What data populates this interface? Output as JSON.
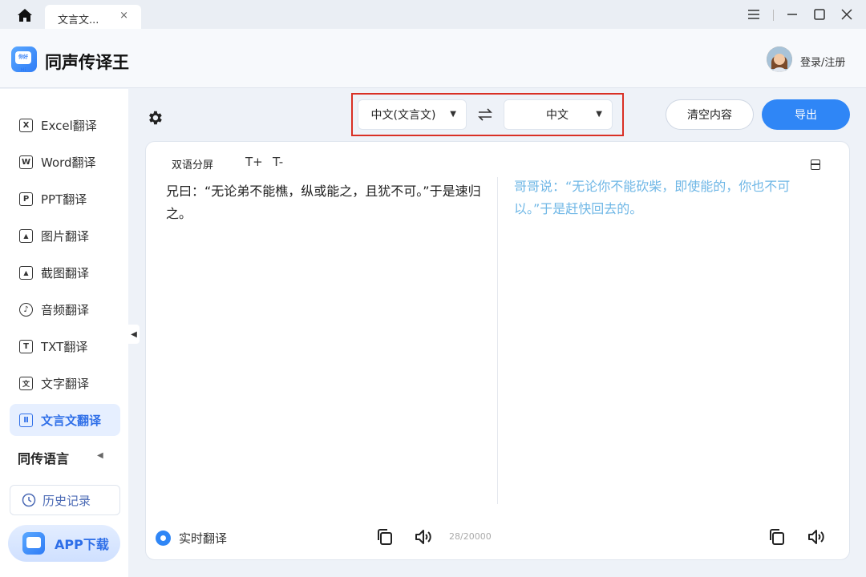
{
  "titlebar": {
    "tab_label": "文言文...",
    "tab_close": "×"
  },
  "header": {
    "app_title": "同声传译王",
    "logo_text": "你好 Hi",
    "login_label": "登录/注册"
  },
  "sidebar": {
    "items": [
      {
        "label": "Excel翻译",
        "icon": "X"
      },
      {
        "label": "Word翻译",
        "icon": "W"
      },
      {
        "label": "PPT翻译",
        "icon": "P"
      },
      {
        "label": "图片翻译",
        "icon": "▲"
      },
      {
        "label": "截图翻译",
        "icon": "▲"
      },
      {
        "label": "音频翻译",
        "icon": "♪"
      },
      {
        "label": "TXT翻译",
        "icon": "T"
      },
      {
        "label": "文字翻译",
        "icon": "文"
      },
      {
        "label": "文言文翻译",
        "icon": "Ⅱ"
      }
    ],
    "section_title": "同传语言",
    "history_label": "历史记录",
    "app_download_label": "APP下载"
  },
  "toolbar": {
    "source_lang": "中文(文言文)",
    "target_lang": "中文",
    "clear_label": "清空内容",
    "export_label": "导出"
  },
  "panel": {
    "bilingual_label": "双语分屏",
    "font_increase": "T+",
    "font_decrease": "T-",
    "source_text": "兄曰：“无论弟不能樵，纵或能之，且犹不可。”于是速归之。",
    "target_text": "哥哥说：“无论你不能砍柴，即使能的，你也不可以。”于是赶快回去的。",
    "realtime_label": "实时翻译",
    "char_count": "28/20000"
  },
  "colors": {
    "accent": "#2f86f6",
    "active_bg": "#e6efff",
    "highlight_border": "#d93025",
    "target_text": "#6fb7e6"
  }
}
